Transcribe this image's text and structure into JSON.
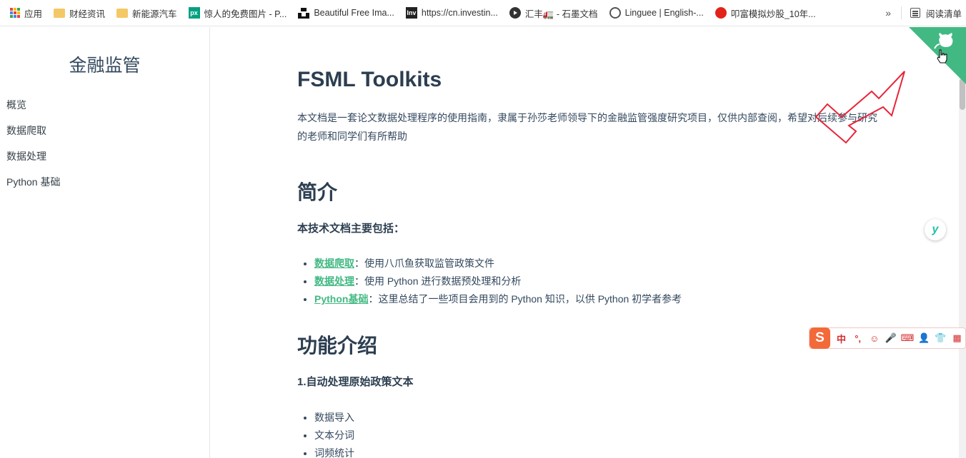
{
  "bookmarks": [
    {
      "label": "应用",
      "icon": "apps-icon"
    },
    {
      "label": "财经资讯",
      "icon": "folder-icon"
    },
    {
      "label": "新能源汽车",
      "icon": "folder-icon"
    },
    {
      "label": "惊人的免费图片 - P...",
      "icon": "pexels-icon",
      "icon_text": "px"
    },
    {
      "label": "Beautiful Free Ima...",
      "icon": "unsplash-icon"
    },
    {
      "label": "https://cn.investin...",
      "icon": "investing-icon",
      "icon_text": "Inv"
    },
    {
      "label": "汇丰🚛 - 石墨文档",
      "icon": "shimo-icon"
    },
    {
      "label": "Linguee | English-...",
      "icon": "globe-icon"
    },
    {
      "label": "叩富模拟炒股_10年...",
      "icon": "koufu-icon"
    }
  ],
  "bookmarks_more": "»",
  "reading_list": "阅读清单",
  "sidebar": {
    "title": "金融监管",
    "items": [
      "概览",
      "数据爬取",
      "数据处理",
      "Python 基础"
    ]
  },
  "main": {
    "title": "FSML Toolkits",
    "intro": "本文档是一套论文数据处理程序的使用指南，隶属于孙莎老师领导下的金融监管强度研究项目，仅供内部查阅，希望对后续参与研究的老师和同学们有所帮助",
    "section1": {
      "heading": "简介",
      "subheading": "本技术文档主要包括：",
      "items": [
        {
          "link": "数据爬取",
          "text": "：使用八爪鱼获取监管政策文件"
        },
        {
          "link": "数据处理",
          "text": "：使用 Python 进行数据预处理和分析"
        },
        {
          "link": "Python基础",
          "text": "：这里总结了一些项目会用到的 Python 知识，以供 Python 初学者参考"
        }
      ]
    },
    "section2": {
      "heading": "功能介绍",
      "subheading": "1.自动处理原始政策文本",
      "items": [
        "数据导入",
        "文本分词",
        "词频统计"
      ]
    }
  },
  "widgets": {
    "y_button": "y",
    "ime_logo": "S",
    "ime_items": [
      "中",
      "°,",
      "☺",
      "🎤",
      "⌨",
      "👤",
      "👕",
      "▦"
    ]
  },
  "colors": {
    "accent": "#42b983",
    "corner": "#42b983",
    "arrow": "#e8243a"
  }
}
